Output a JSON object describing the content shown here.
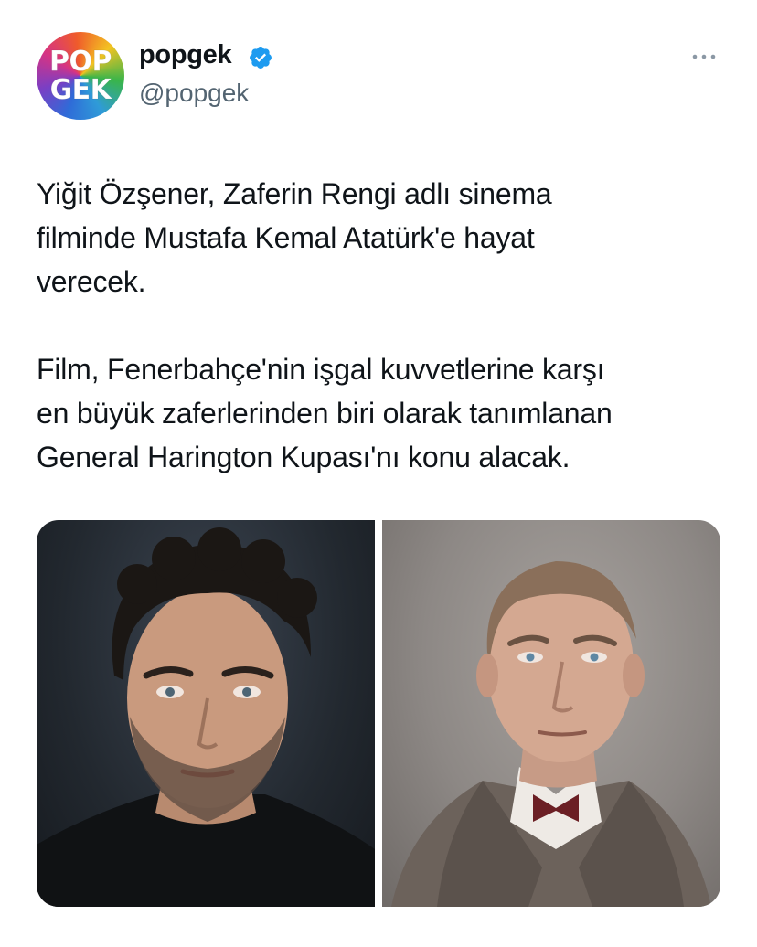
{
  "author": {
    "display_name": "popgek",
    "username": "@popgek",
    "avatar_text": [
      "POP",
      "GEK"
    ],
    "verified": true,
    "verified_color": "#1d9bf0"
  },
  "tweet": {
    "text": "Yiğit Özşener, Zaferin Rengi adlı sinema\nfilminde Mustafa Kemal Atatürk'e hayat\nverecek.\n\nFilm, Fenerbahçe'nin işgal kuvvetlerine karşı\nen büyük zaferlerinden biri olarak tanımlanan\nGeneral Harington Kupası'nı konu alacak."
  },
  "media": {
    "count": 2
  },
  "colors": {
    "text": "#0f1419",
    "secondary_text": "#536471",
    "accent": "#1d9bf0"
  },
  "icons": [
    "verified-badge-icon",
    "more-options-icon"
  ]
}
